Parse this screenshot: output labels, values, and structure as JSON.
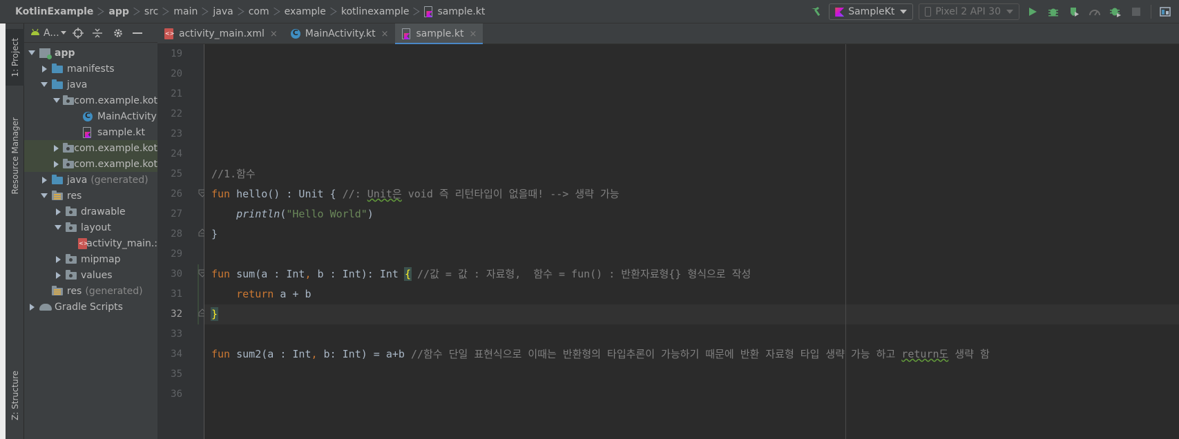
{
  "breadcrumbs": {
    "items": [
      "KotlinExample",
      "app",
      "src",
      "main",
      "java",
      "com",
      "example",
      "kotlinexample",
      "sample.kt"
    ]
  },
  "toolbar": {
    "run_config": "SampleKt",
    "device": "Pixel 2 API 30",
    "icons": [
      "hammer-icon",
      "run-icon",
      "debug-icon",
      "coverage-icon",
      "profile-icon",
      "attach-debugger-icon",
      "stop-icon",
      "project-structure-icon"
    ]
  },
  "side_tabs": {
    "project": "1: Project",
    "resource_manager": "Resource Manager",
    "structure": "Z: Structure"
  },
  "project_panel": {
    "view_label": "A..."
  },
  "tree": [
    {
      "label": "app",
      "bold": true
    },
    {
      "label": "manifests"
    },
    {
      "label": "java"
    },
    {
      "label": "com.example.kot"
    },
    {
      "label": "MainActivity"
    },
    {
      "label": "sample.kt"
    },
    {
      "label": "com.example.kot"
    },
    {
      "label": "com.example.kot"
    },
    {
      "label": "java",
      "suffix": "(generated)"
    },
    {
      "label": "res"
    },
    {
      "label": "drawable"
    },
    {
      "label": "layout"
    },
    {
      "label": "activity_main.:"
    },
    {
      "label": "mipmap"
    },
    {
      "label": "values"
    },
    {
      "label": "res",
      "suffix": "(generated)"
    },
    {
      "label": "Gradle Scripts"
    }
  ],
  "tabs": [
    {
      "label": "activity_main.xml",
      "close": "×"
    },
    {
      "label": "MainActivity.kt",
      "close": "×"
    },
    {
      "label": "sample.kt",
      "close": "×",
      "active": true
    }
  ],
  "editor": {
    "current_line": 32,
    "line_numbers": [
      "19",
      "20",
      "21",
      "22",
      "23",
      "24",
      "25",
      "26",
      "27",
      "28",
      "29",
      "30",
      "31",
      "32",
      "33",
      "34",
      "35",
      "36"
    ],
    "code": {
      "l25_comment": "//1.함수",
      "l26_kw": "fun",
      "l26_sig": " hello() : Unit { ",
      "l26_cmt_a": "//: ",
      "l26_cmt_warn": "Unit은",
      "l26_cmt_b": " void 즉 리턴타입이 없을때! --> 생략 가능",
      "l27_fn": "println",
      "l27_open": "(",
      "l27_str": "\"Hello World\"",
      "l27_close": ")",
      "l28": "}",
      "l30_kw": "fun",
      "l30_sig_a": " sum(a : Int",
      "l30_comma": ",",
      "l30_sig_b": " b : Int): Int ",
      "l30_brace": "{",
      "l30_cmt": " //값 = 값 : 자료형,  함수 = fun() : 반환자료형{} 형식으로 작성",
      "l31_kw": "return",
      "l31_rest": " a + b",
      "l32": "}",
      "l34_kw": "fun",
      "l34_sig_a": " sum2(a : Int",
      "l34_comma": ",",
      "l34_sig_b": " b: Int) = a+b ",
      "l34_cmt_a": "//함수 단일 표현식으로 이때는 반환형의 타입추론이 가능하기 때문에 반환 자료형 타입 생략 가능 하고 ",
      "l34_cmt_warn": "return도",
      "l34_cmt_b": " 생략 함"
    }
  },
  "colors": {
    "keyword": "#cc7832",
    "comment": "#808080",
    "string": "#6a8759",
    "default_code": "#a9b7c6",
    "tab_underline": "#4a88c7",
    "run_green": "#59a869"
  }
}
